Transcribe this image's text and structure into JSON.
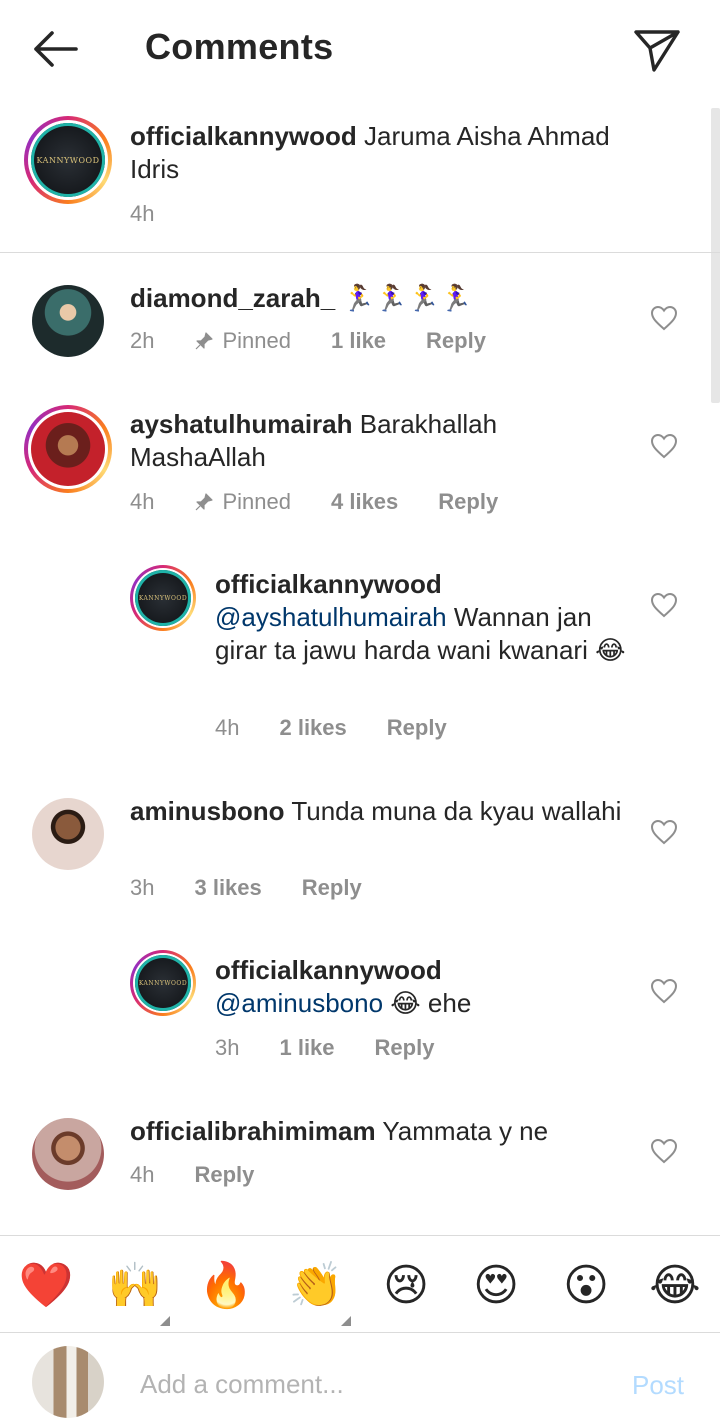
{
  "header": {
    "title": "Comments",
    "back_icon": "arrow-left-icon",
    "send_icon": "paper-plane-icon"
  },
  "caption": {
    "username": "officialkannywood",
    "text": "Jaruma Aisha Ahmad Idris",
    "time": "4h",
    "avatar_logo_text": "KANNYWOOD"
  },
  "comments": [
    {
      "username": "diamond_zarah_",
      "text": "🏃‍♀️🏃‍♀️🏃‍♀️🏃‍♀️",
      "time": "2h",
      "pinned": "Pinned",
      "likes": "1 like",
      "reply": "Reply"
    },
    {
      "username": "ayshatulhumairah",
      "text": "Barakhallah MashaAllah",
      "time": "4h",
      "pinned": "Pinned",
      "likes": "4 likes",
      "reply": "Reply"
    },
    {
      "username": "officialkannywood",
      "mention": "@ayshatulhumairah",
      "text": "Wannan jan girar ta jawu harda wani kwanari 😂",
      "time": "4h",
      "likes": "2 likes",
      "reply": "Reply"
    },
    {
      "username": "aminusbono",
      "text": "Tunda muna da kyau wallahi",
      "time": "3h",
      "likes": "3 likes",
      "reply": "Reply"
    },
    {
      "username": "officialkannywood",
      "mention": "@aminusbono",
      "text": "😂 ehe",
      "time": "3h",
      "likes": "1 like",
      "reply": "Reply"
    },
    {
      "username": "officialibrahimimam",
      "text": "Yammata y ne",
      "time": "4h",
      "reply": "Reply"
    }
  ],
  "reactions": [
    "❤️",
    "🙌",
    "🔥",
    "👏",
    "😢",
    "😍",
    "😮",
    "😂"
  ],
  "composer": {
    "placeholder": "Add a comment...",
    "post_label": "Post"
  },
  "colors": {
    "text": "#262626",
    "secondary": "#8e8e8e",
    "mention": "#00376b",
    "post_disabled": "#b3dbff"
  }
}
